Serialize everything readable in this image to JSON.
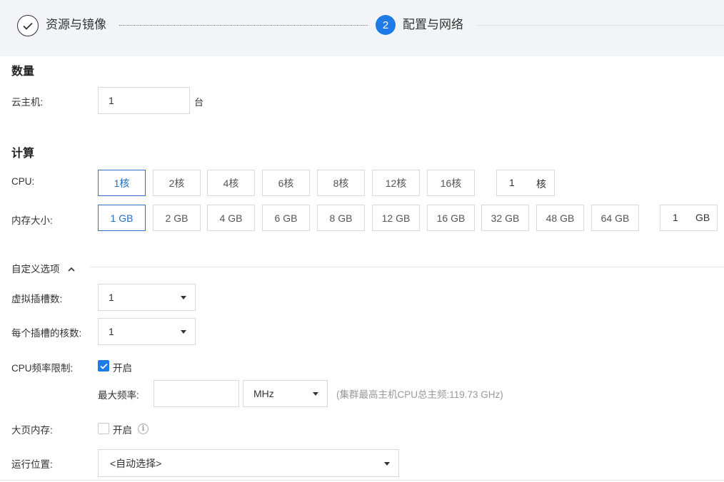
{
  "steps": [
    {
      "label": "资源与镜像",
      "state": "done"
    },
    {
      "label": "配置与网络",
      "number": "2",
      "state": "active"
    }
  ],
  "colors": {
    "accent": "#1e7be6",
    "selected_border": "#2f74c8",
    "header_bg": "#f3f4f7"
  },
  "quantity": {
    "title": "数量",
    "vm_label": "云主机:",
    "vm_value": "1",
    "vm_unit": "台"
  },
  "compute": {
    "title": "计算",
    "cpu_label": "CPU:",
    "cpu_options": [
      "1核",
      "2核",
      "4核",
      "6核",
      "8核",
      "12核",
      "16核"
    ],
    "cpu_selected": "1核",
    "cpu_custom_value": "1",
    "cpu_custom_unit": "核",
    "mem_label": "内存大小:",
    "mem_options": [
      "1 GB",
      "2 GB",
      "4 GB",
      "6 GB",
      "8 GB",
      "12 GB",
      "16 GB",
      "32 GB",
      "48 GB",
      "64 GB"
    ],
    "mem_selected": "1 GB",
    "mem_custom_value": "1",
    "mem_custom_unit": "GB"
  },
  "custom": {
    "title": "自定义选项",
    "expanded": true,
    "sockets_label": "虚拟插槽数:",
    "sockets_value": "1",
    "cores_label": "每个插槽的核数:",
    "cores_value": "1",
    "cpu_limit_label": "CPU频率限制:",
    "cpu_limit_checked": true,
    "cpu_limit_text": "开启",
    "max_freq_label": "最大频率:",
    "max_freq_value": "",
    "max_freq_unit": "MHz",
    "max_freq_hint": "(集群最高主机CPU总主频:119.73 GHz)",
    "hugepage_label": "大页内存:",
    "hugepage_checked": false,
    "hugepage_text": "开启",
    "location_label": "运行位置:",
    "location_value": "<自动选择>"
  }
}
